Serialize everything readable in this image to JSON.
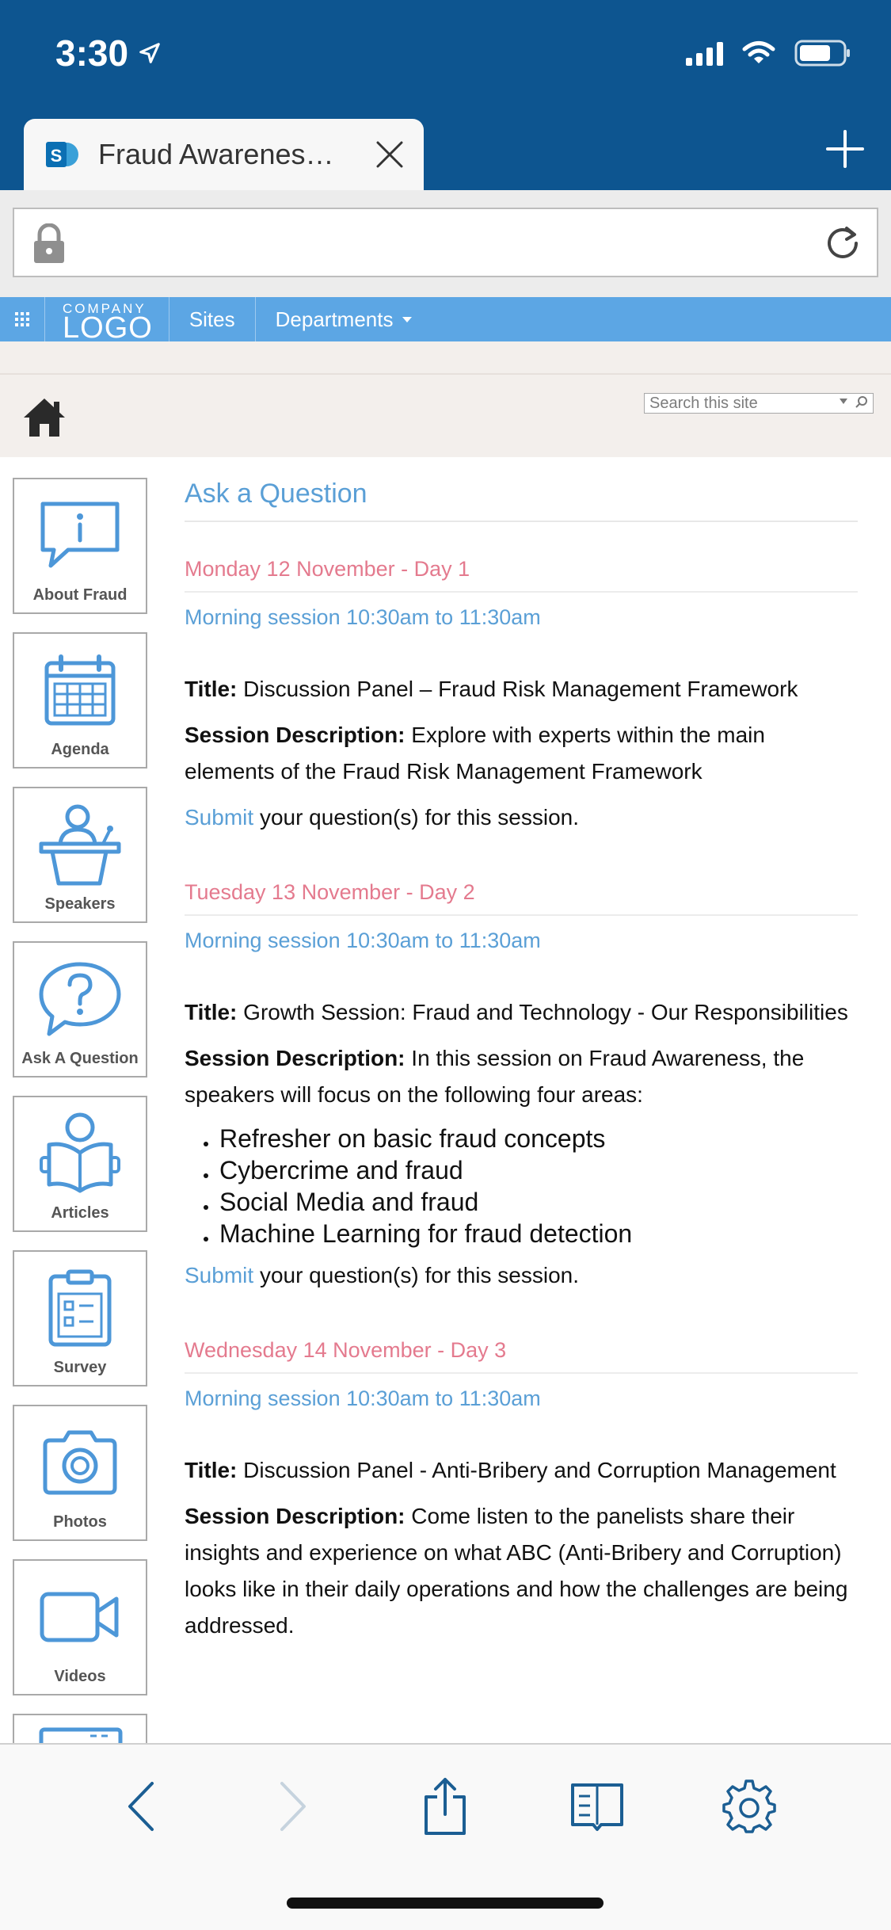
{
  "status_bar": {
    "time": "3:30"
  },
  "browser": {
    "tab_title": "Fraud Awarenes…",
    "address": ""
  },
  "suite_bar": {
    "logo_small": "COMPANY",
    "logo_big": "LOGO",
    "nav": [
      "Sites",
      "Departments"
    ]
  },
  "search": {
    "placeholder": "Search this site"
  },
  "tiles": [
    {
      "label": "About Fraud",
      "icon": "info-bubble-icon"
    },
    {
      "label": "Agenda",
      "icon": "calendar-icon"
    },
    {
      "label": "Speakers",
      "icon": "podium-speaker-icon"
    },
    {
      "label": "Ask A Question",
      "icon": "question-bubble-icon"
    },
    {
      "label": "Articles",
      "icon": "reading-person-icon"
    },
    {
      "label": "Survey",
      "icon": "clipboard-checklist-icon"
    },
    {
      "label": "Photos",
      "icon": "camera-icon"
    },
    {
      "label": "Videos",
      "icon": "video-camera-icon"
    }
  ],
  "main": {
    "title": "Ask a Question",
    "days": [
      {
        "heading": "Monday 12 November - Day 1",
        "session": "Morning session 10:30am to 11:30am",
        "title_label": "Title:",
        "title": "Discussion Panel – Fraud Risk Management Framework",
        "desc_label": "Session Description:",
        "desc": "Explore with experts within the main elements of the Fraud Risk Management Framework",
        "submit_link": "Submit",
        "submit_text": "your question(s) for this session."
      },
      {
        "heading": "Tuesday 13 November - Day 2",
        "session": "Morning session 10:30am to 11:30am",
        "title_label": "Title:",
        "title": "Growth Session: Fraud and Technology - Our Responsibilities",
        "desc_label": "Session Description:",
        "desc": "In this session on Fraud Awareness, the speakers will focus on the following four areas:",
        "bullets": [
          "Refresher on basic fraud concepts",
          "Cybercrime and fraud",
          "Social Media and fraud",
          "Machine Learning for fraud detection"
        ],
        "submit_link": "Submit",
        "submit_text": "your question(s) for this session."
      },
      {
        "heading": "Wednesday 14 November - Day 3",
        "session": "Morning session 10:30am to 11:30am",
        "title_label": "Title:",
        "title": "Discussion Panel - Anti-Bribery and Corruption Management",
        "desc_label": "Session Description:",
        "desc": "Come listen to the panelists share their insights and experience on what ABC (Anti-Bribery and Corruption) looks like in their daily operations and how the challenges are being addressed."
      }
    ]
  },
  "toolbar": {
    "buttons": [
      "back-icon",
      "forward-icon",
      "share-icon",
      "bookmarks-icon",
      "settings-gear-icon"
    ]
  }
}
